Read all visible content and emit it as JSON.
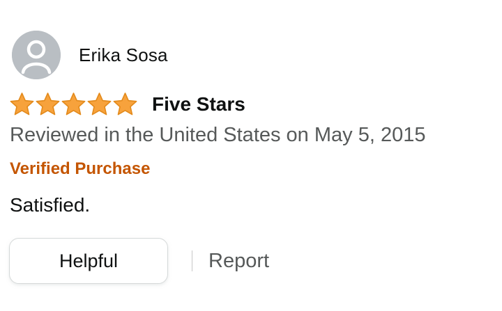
{
  "review": {
    "reviewer_name": "Erika Sosa",
    "avatar_icon": "person-silhouette-icon",
    "rating": 5,
    "rating_max": 5,
    "title": "Five Stars",
    "date_line": "Reviewed in the United States on May 5, 2015",
    "verified_label": "Verified Purchase",
    "body": "Satisfied."
  },
  "actions": {
    "helpful_label": "Helpful",
    "report_label": "Report"
  },
  "colors": {
    "star_fill": "#f7a23c",
    "star_stroke": "#e38a1b",
    "verified": "#c45500",
    "secondary_text": "#565959",
    "avatar_bg": "#b9bec3"
  }
}
